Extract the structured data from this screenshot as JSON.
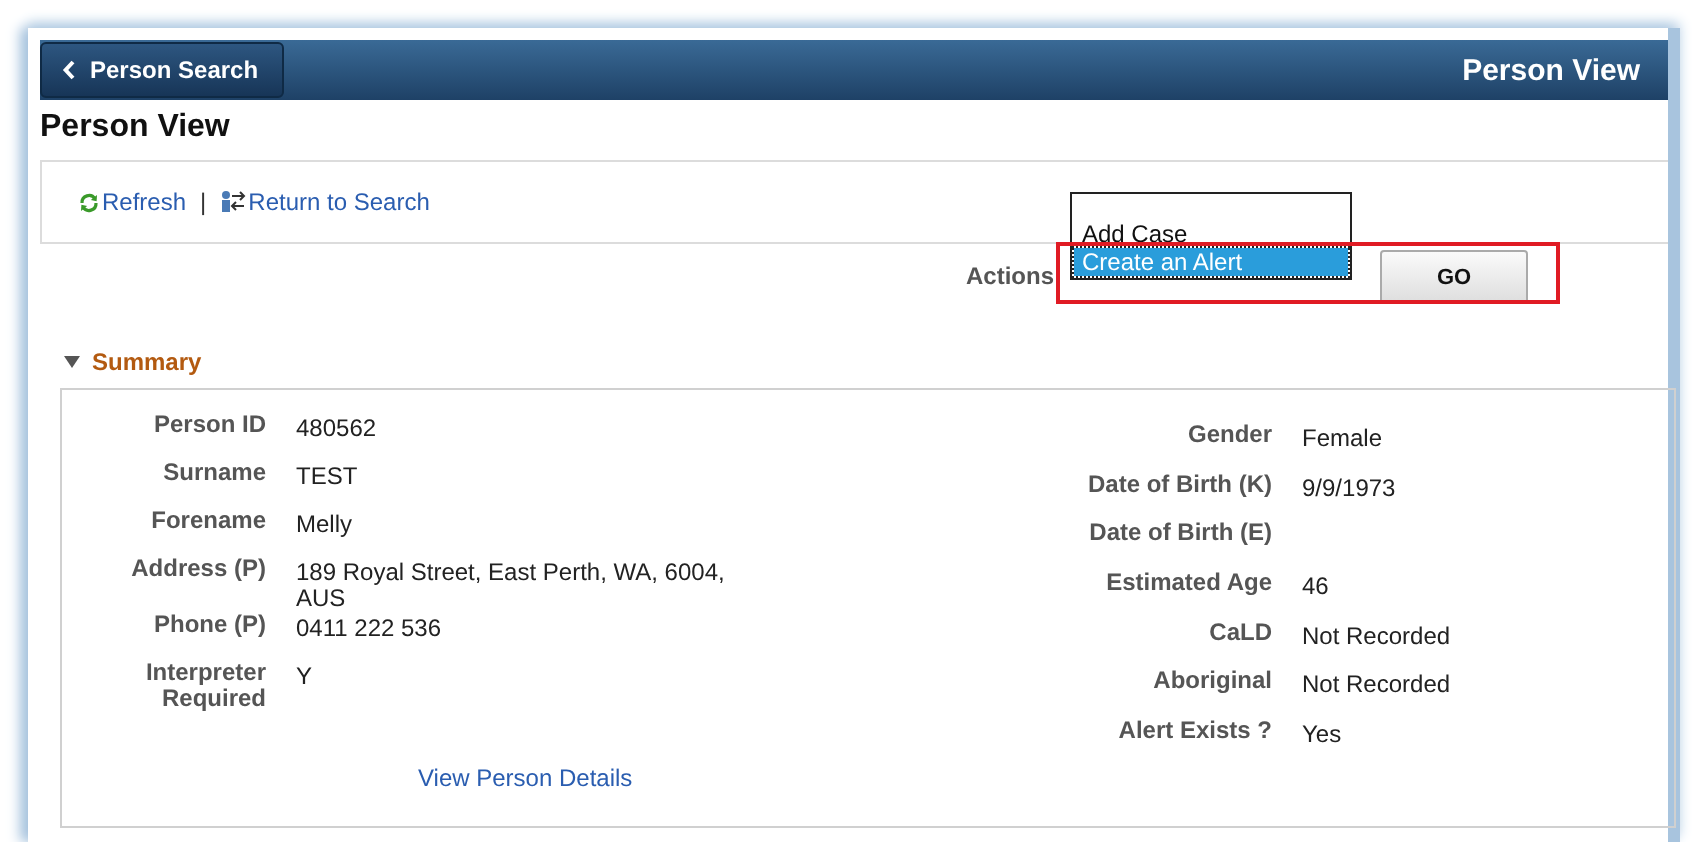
{
  "header": {
    "back_button": "Person Search",
    "title": "Person View"
  },
  "page_title": "Person View",
  "toolbar": {
    "links": [
      {
        "kind": "refresh",
        "label": "Refresh"
      },
      {
        "kind": "return",
        "label": "Return to Search"
      }
    ],
    "separator": "|"
  },
  "actions": {
    "label": "Actions",
    "options": [
      {
        "label": "Add Case",
        "selected": false
      },
      {
        "label": "Create an Alert",
        "selected": true
      }
    ],
    "button": "GO",
    "highlighted": true
  },
  "summary": {
    "title": "Summary",
    "expanded": true,
    "left_fields": [
      {
        "label": "Person ID",
        "value": "480562"
      },
      {
        "label": "Surname",
        "value": "TEST"
      },
      {
        "label": "Forename",
        "value": "Melly"
      },
      {
        "label": "Address (P)",
        "value": "189 Royal Street, East Perth, WA, 6004, AUS"
      },
      {
        "label": "Phone (P)",
        "value": "0411 222 536"
      },
      {
        "label": "Interpreter Required",
        "value": "Y"
      }
    ],
    "right_fields": [
      {
        "label": "Gender",
        "value": "Female"
      },
      {
        "label": "Date of Birth (K)",
        "value": "9/9/1973"
      },
      {
        "label": "Date of Birth (E)"
      },
      {
        "label": "Estimated Age",
        "value": "46"
      },
      {
        "label": "CaLD",
        "value": "Not Recorded"
      },
      {
        "label": "Aboriginal",
        "value": "Not Recorded"
      },
      {
        "label": "Alert Exists ?",
        "value": "Yes"
      }
    ],
    "link": "View Person Details"
  }
}
